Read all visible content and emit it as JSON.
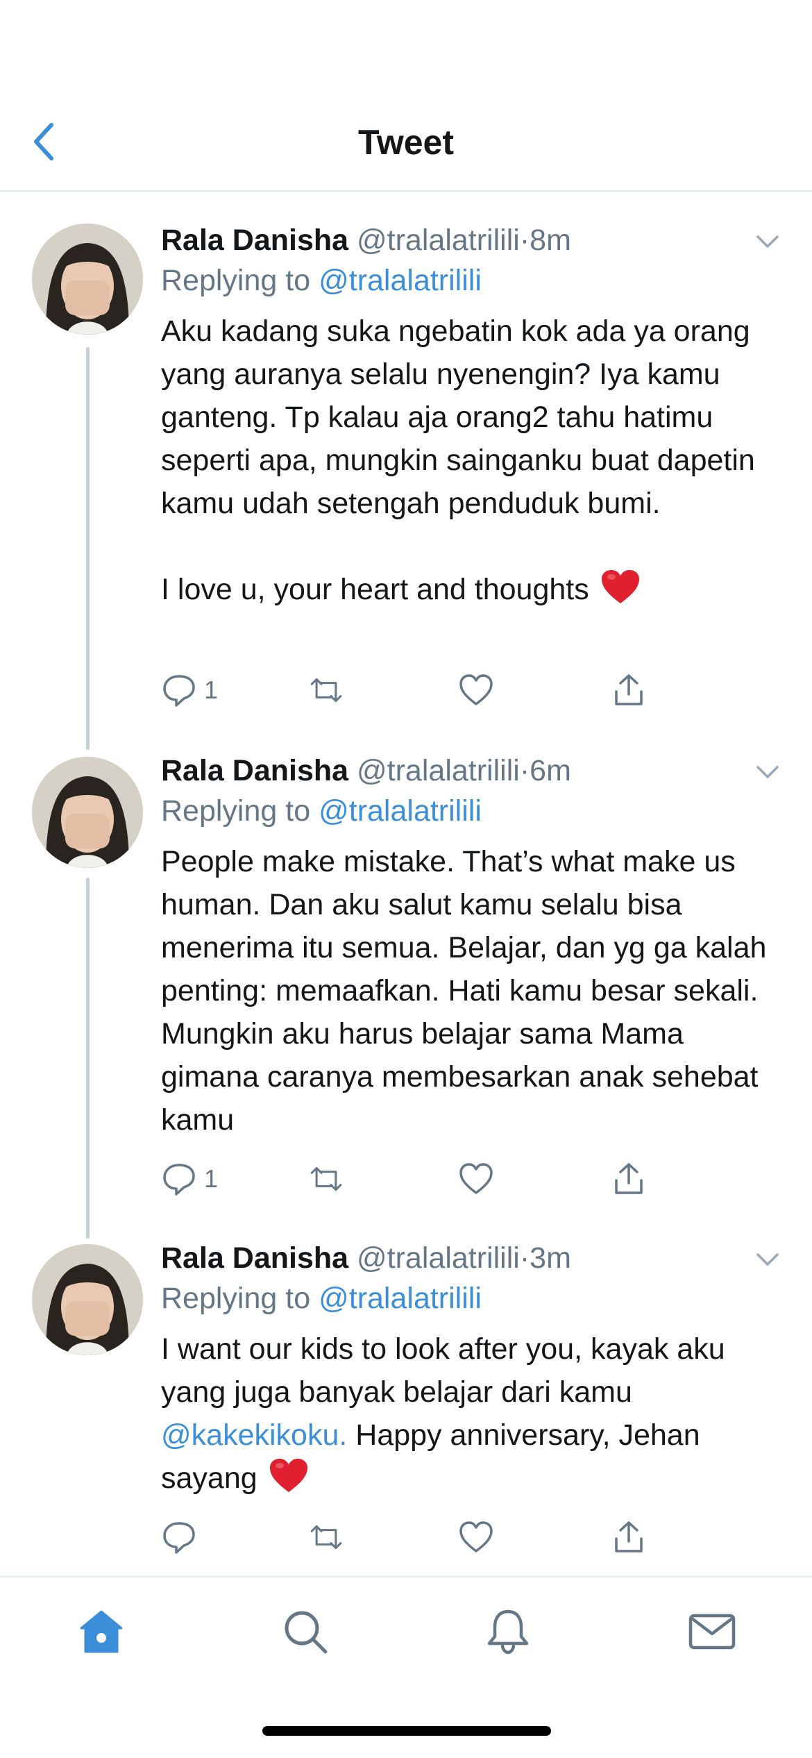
{
  "header": {
    "title": "Tweet"
  },
  "tweets": [
    {
      "name": "Rala Danisha",
      "handle": "@tralalatrilili",
      "dot": "·",
      "time": "8m",
      "replying_prefix": "Replying to",
      "replying_to": "@tralalatrilili",
      "text_part1": "Aku kadang suka ngebatin kok ada ya orang yang auranya selalu nyenengin? Iya kamu ganteng. Tp kalau aja orang2 tahu hatimu seperti apa, mungkin sainganku buat dapetin kamu udah setengah penduduk bumi.\n\nI love u, your heart and thoughts",
      "reply_count": "1"
    },
    {
      "name": "Rala Danisha",
      "handle": "@tralalatrilili",
      "dot": "·",
      "time": "6m",
      "replying_prefix": "Replying to",
      "replying_to": "@tralalatrilili",
      "text_part1": "People make mistake. That’s what make us human. Dan aku salut kamu selalu bisa menerima itu semua. Belajar, dan yg ga kalah penting: memaafkan. Hati kamu besar sekali. Mungkin aku harus belajar sama Mama gimana caranya membesarkan anak sehebat kamu",
      "reply_count": "1"
    },
    {
      "name": "Rala Danisha",
      "handle": "@tralalatrilili",
      "dot": "·",
      "time": "3m",
      "replying_prefix": "Replying to",
      "replying_to": "@tralalatrilili",
      "text_part1": "I want our kids to look after you, kayak aku yang juga banyak belajar dari kamu ",
      "mention": "@kakekikoku.",
      "text_part2": " Happy anniversary, Jehan sayang",
      "reply_count": ""
    }
  ],
  "icons": {
    "back": "chevron-left-icon",
    "menu": "chevron-down-icon",
    "reply": "comment-icon",
    "retweet": "retweet-icon",
    "like": "heart-icon",
    "share": "share-icon",
    "emoji": "red-heart-emoji",
    "tabs": [
      "home-icon",
      "search-icon",
      "bell-icon",
      "mail-icon"
    ]
  },
  "colors": {
    "accent": "#3b8fd9",
    "text": "#14171a",
    "muted": "#657786",
    "divider": "#e1e8ed",
    "thread_line": "#c4cfd6",
    "heart_emoji": "#e0202f"
  }
}
